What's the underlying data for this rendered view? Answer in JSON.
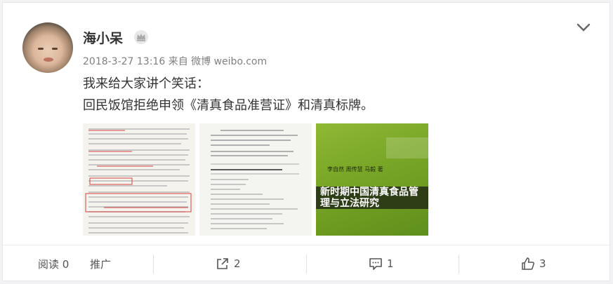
{
  "post": {
    "username": "海小呆",
    "meta": "2018-3-27 13:16 来自 微博 weibo.com",
    "text_line1": "我来给大家讲个笑话：",
    "text_line2": "回民饭馆拒绝申领《清真食品准营证》和清真标牌。"
  },
  "images": {
    "book_title": "新时期中国清真食品管理与立法研究",
    "book_authors": "李自然 周传慧 马毅 著"
  },
  "actions": {
    "read_label": "阅读 0",
    "promote_label": "推广",
    "repost_count": "2",
    "comment_count": "1",
    "like_count": "3"
  },
  "icons": {
    "vip": "crown-badge-icon",
    "menu": "chevron-down-icon",
    "repost": "share-icon",
    "comment": "comment-icon",
    "like": "thumbs-up-icon"
  },
  "colors": {
    "book_cover_green": "#77a526",
    "text": "#333333",
    "meta": "#808080"
  }
}
